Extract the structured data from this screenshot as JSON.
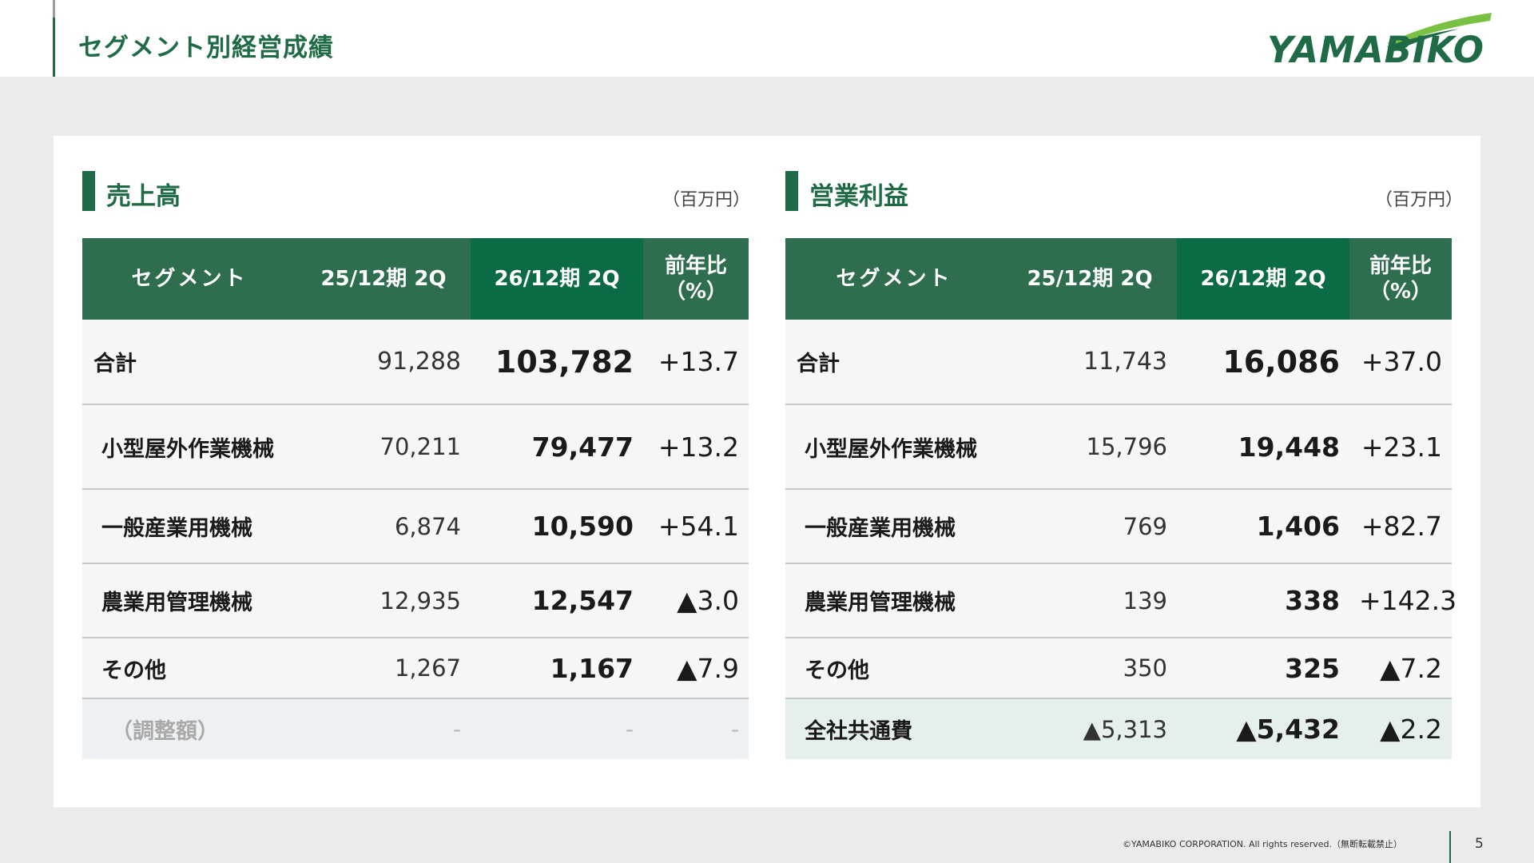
{
  "header": {
    "title": "セグメント別経営成績",
    "logo_text": "YAMABIKO"
  },
  "sales": {
    "title": "売上高",
    "unit": "（百万円）",
    "columns": {
      "segment": "セグメント",
      "prev": "25/12期 2Q",
      "cur": "26/12期 2Q",
      "yoy_line1": "前年比",
      "yoy_line2": "（%）"
    },
    "rows": [
      {
        "name": "合計",
        "prev": "91,288",
        "cur": "103,782",
        "yoy": "+13.7"
      },
      {
        "name": "小型屋外作業機械",
        "prev": "70,211",
        "cur": "79,477",
        "yoy": "+13.2"
      },
      {
        "name": "一般産業用機械",
        "prev": "6,874",
        "cur": "10,590",
        "yoy": "+54.1"
      },
      {
        "name": "農業用管理機械",
        "prev": "12,935",
        "cur": "12,547",
        "yoy": "▲3.0"
      },
      {
        "name": "その他",
        "prev": "1,267",
        "cur": "1,167",
        "yoy": "▲7.9"
      },
      {
        "name": "（調整額）",
        "prev": "-",
        "cur": "-",
        "yoy": "-"
      }
    ]
  },
  "profit": {
    "title": "営業利益",
    "unit": "（百万円）",
    "columns": {
      "segment": "セグメント",
      "prev": "25/12期 2Q",
      "cur": "26/12期 2Q",
      "yoy_line1": "前年比",
      "yoy_line2": "（%）"
    },
    "rows": [
      {
        "name": "合計",
        "prev": "11,743",
        "cur": "16,086",
        "yoy": "+37.0"
      },
      {
        "name": "小型屋外作業機械",
        "prev": "15,796",
        "cur": "19,448",
        "yoy": "+23.1"
      },
      {
        "name": "一般産業用機械",
        "prev": "769",
        "cur": "1,406",
        "yoy": "+82.7"
      },
      {
        "name": "農業用管理機械",
        "prev": "139",
        "cur": "338",
        "yoy": "+142.3"
      },
      {
        "name": "その他",
        "prev": "350",
        "cur": "325",
        "yoy": "▲7.2"
      },
      {
        "name": "全社共通費",
        "prev": "▲5,313",
        "cur": "▲5,432",
        "yoy": "▲2.2"
      }
    ]
  },
  "footer": {
    "copyright": "©YAMABIKO CORPORATION. All rights reserved.（無断転載禁止）",
    "page_number": "5"
  },
  "colors": {
    "brand_green": "#1f6b46",
    "header_cell": "#2e6e4f",
    "highlight_header_cell": "#0b6b45",
    "logo_swoosh": "#7ac043"
  }
}
